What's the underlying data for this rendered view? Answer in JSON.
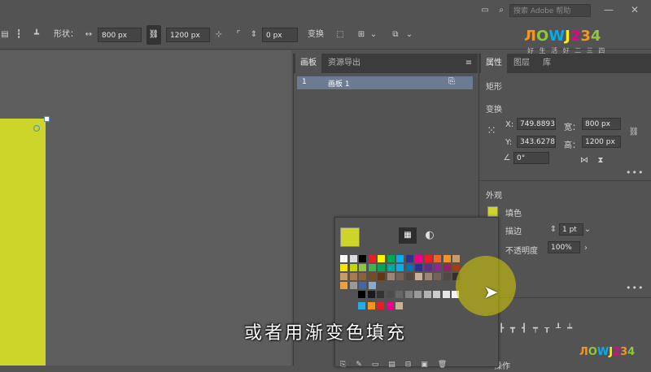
{
  "topbar": {
    "search_placeholder": "搜索 Adobe 帮助",
    "minimize": "—",
    "close": "✕"
  },
  "control_bar": {
    "shape_label": "形状：",
    "width_value": "800 px",
    "height_value": "1200 px",
    "angle_value": "0 px",
    "transform_label": "变换"
  },
  "artboards_panel": {
    "tabs": [
      "画板",
      "资源导出"
    ],
    "row_index": "1",
    "row_name": "画板 1"
  },
  "properties_panel": {
    "tabs": [
      "属性",
      "图层",
      "库"
    ],
    "object_type": "矩形",
    "transform_title": "变换",
    "x_label": "X:",
    "x_value": "749.8893",
    "y_label": "Y:",
    "y_value": "343.6278",
    "w_label": "宽：",
    "w_value": "800 px",
    "h_label": "高：",
    "h_value": "1200 px",
    "rotation_value": "0°",
    "appearance_title": "外观",
    "fill_label": "填色",
    "stroke_label": "描边",
    "stroke_value": "1 pt",
    "opacity_label": "不透明度",
    "opacity_value": "100%",
    "bottom_label": "操作"
  },
  "swatch_popup": {
    "current_fill_color": "#cdd42a",
    "row1": [
      "#ffffff",
      "#dcdcdc",
      "#000000",
      "#ed1c24",
      "#fff200",
      "#00a651",
      "#00aeef",
      "#2e3192",
      "#ec008c",
      "#ed1c24",
      "#f26522",
      "#f7941d",
      "#c69c6d"
    ],
    "row2": [
      "#f5e500",
      "#c4d600",
      "#8dc63f",
      "#39b54a",
      "#00a651",
      "#00a99d",
      "#00aeef",
      "#0072bc",
      "#2e3192",
      "#662d91",
      "#92278f",
      "#9e1f63",
      "#a0410d"
    ],
    "row3": [
      "#c69c6d",
      "#a67c52",
      "#8c6239",
      "#754c24",
      "#603913",
      "#998675",
      "#736357",
      "#534741",
      "#c7b299",
      "#998675",
      "#736357",
      "#534741",
      "#362f2d"
    ],
    "row5": [
      "#000000",
      "#1a1a1a",
      "#333333",
      "#4d4d4d",
      "#666666",
      "#808080",
      "#999999",
      "#b3b3b3",
      "#cccccc",
      "#e6e6e6",
      "#f2f2f2"
    ],
    "row6": [
      "#29abe2",
      "#f7941d",
      "#ed1c24",
      "#ec008c",
      "#c7b299"
    ]
  },
  "subtitle": "或者用渐变色填充",
  "watermark": {
    "text": "ЛOWJ234",
    "tagline": "好 生 活  好 二 三 四"
  },
  "colors": {
    "artboard_fill": "#cdd42a",
    "accent_highlight": "#dad200",
    "panel_bg": "#535353",
    "field_bg": "#444444"
  }
}
